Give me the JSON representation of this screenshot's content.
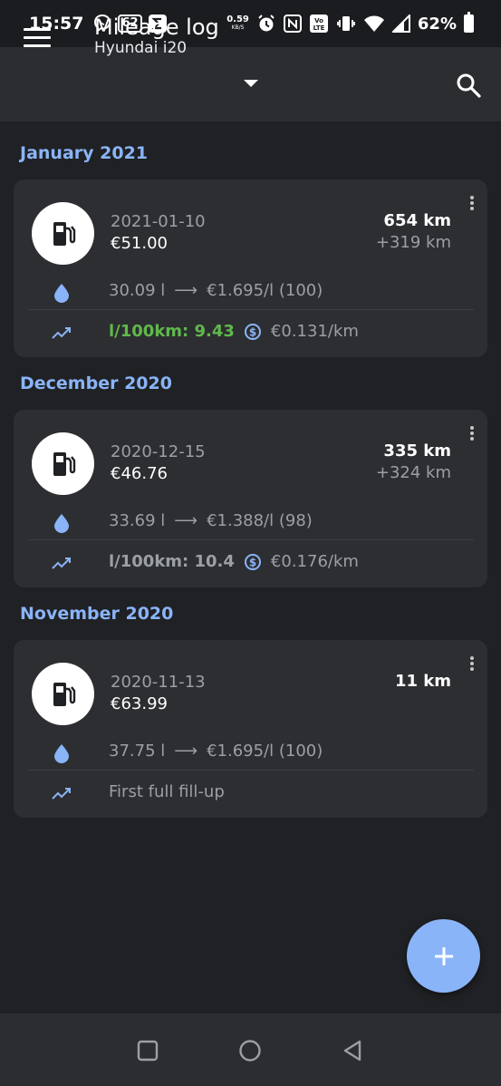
{
  "status_bar": {
    "time": "15:57",
    "notif_count": "62",
    "net_speed": "0.59",
    "net_unit": "KB/S",
    "battery": "62%"
  },
  "appbar": {
    "title": "Mileage log",
    "subtitle": "Hyundai i20"
  },
  "accent_color": "#8ab4f8",
  "good_color": "#5fb94b",
  "entries": [
    {
      "month": "January 2021",
      "date": "2021-01-10",
      "cost": "€51.00",
      "odometer": "654 km",
      "distance": "+319 km",
      "volume": "30.09 l",
      "arrow": "⟶",
      "price": "€1.695/l (100)",
      "efficiency": "l/100km: 9.43",
      "cost_per_km": "€0.131/km"
    },
    {
      "month": "December 2020",
      "date": "2020-12-15",
      "cost": "€46.76",
      "odometer": "335 km",
      "distance": "+324 km",
      "volume": "33.69 l",
      "arrow": "⟶",
      "price": "€1.388/l (98)",
      "efficiency": "l/100km: 10.4",
      "cost_per_km": "€0.176/km"
    },
    {
      "month": "November 2020",
      "date": "2020-11-13",
      "cost": "€63.99",
      "odometer": "11 km",
      "volume": "37.75 l",
      "arrow": "⟶",
      "price": "€1.695/l (100)",
      "note": "First full fill-up"
    }
  ],
  "icons": {
    "menu": "menu-icon",
    "search": "search-icon",
    "fuel": "fuel-pump-icon",
    "drop": "water-drop-icon",
    "trend": "trending-up-icon",
    "coin": "dollar-coin-icon",
    "add": "add-icon"
  }
}
